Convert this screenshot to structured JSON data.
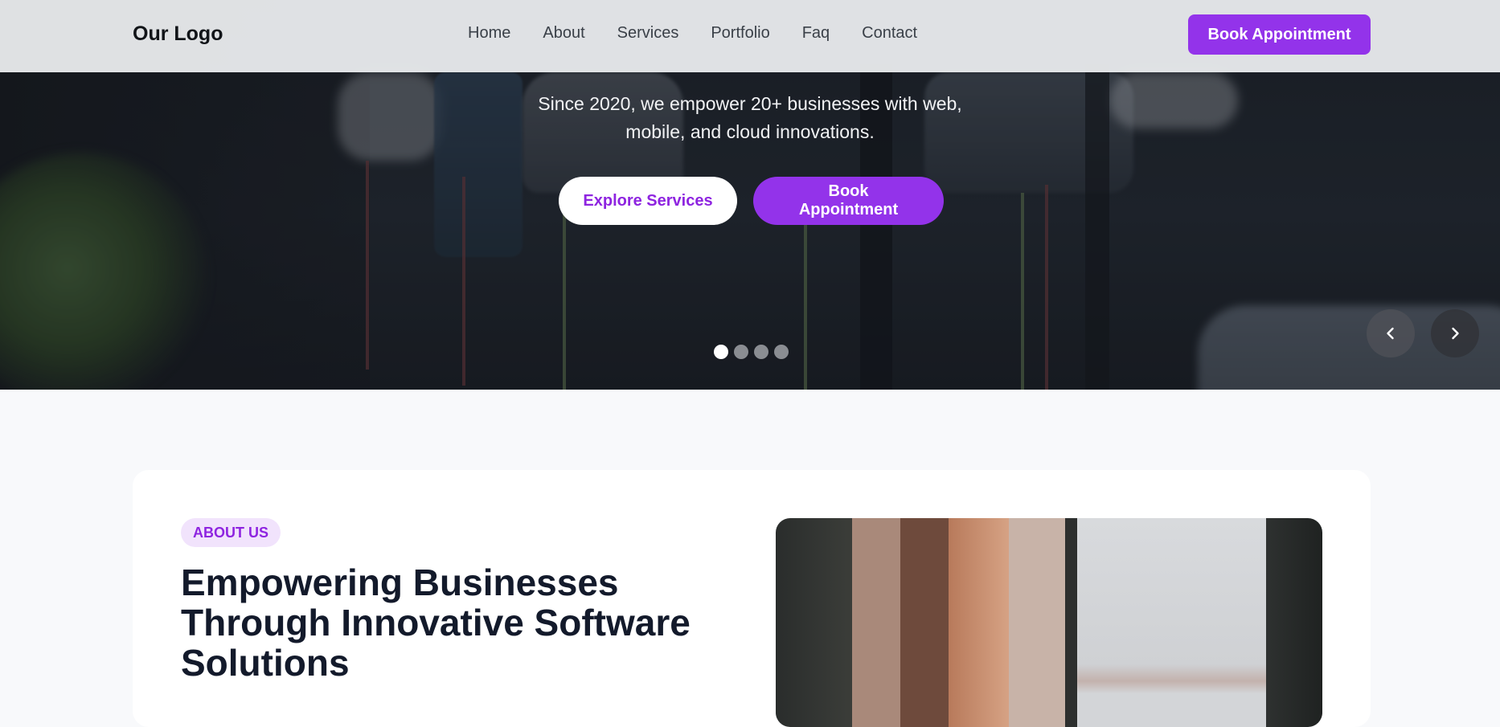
{
  "navbar": {
    "logo": "Our Logo",
    "links": [
      "Home",
      "About",
      "Services",
      "Portfolio",
      "Faq",
      "Contact"
    ],
    "cta": "Book Appointment"
  },
  "hero": {
    "subtitle_line1": "Since 2020, we empower 20+ businesses with web,",
    "subtitle_line2": "mobile, and cloud innovations.",
    "primary_button": "Explore Services",
    "secondary_button": "Book Appointment",
    "slide_count": 4,
    "active_slide": 1,
    "prev_icon": "chevron-left-icon",
    "next_icon": "chevron-right-icon"
  },
  "about": {
    "badge": "ABOUT US",
    "heading_line1": "Empowering Businesses",
    "heading_line2": "Through Innovative Software",
    "heading_line3": "Solutions"
  },
  "colors": {
    "accent": "#9333ea",
    "badge_bg": "#f1e3fc",
    "heading": "#131a2b",
    "page_bg": "#f8f9fb"
  }
}
